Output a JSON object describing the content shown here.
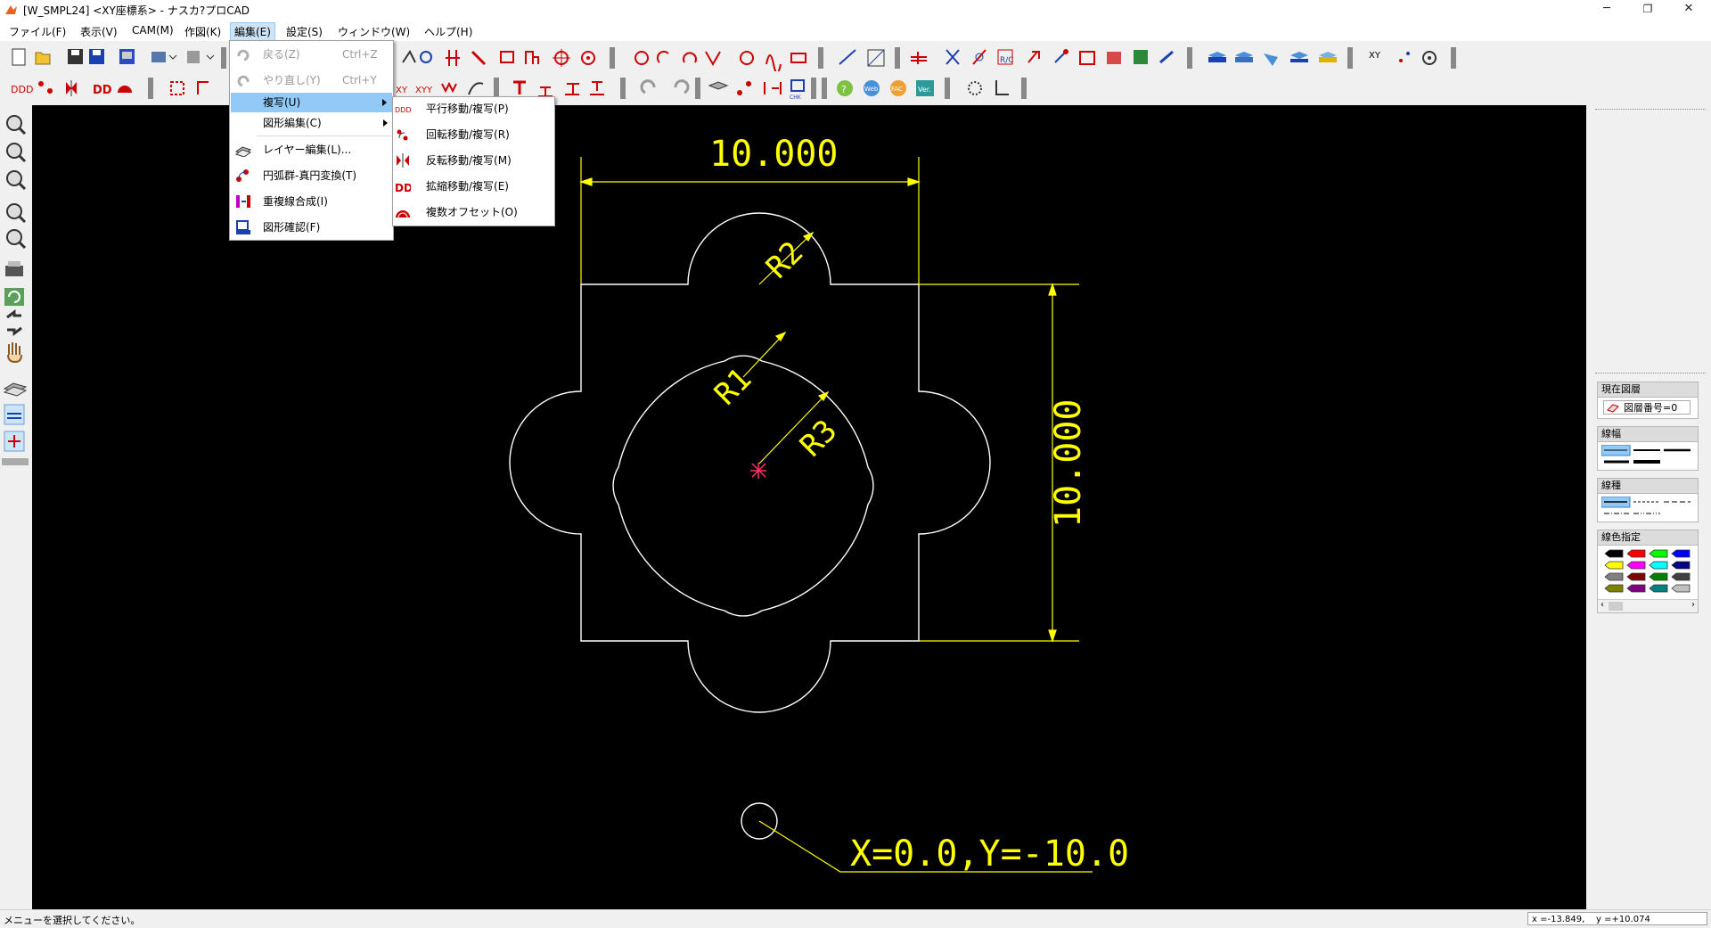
{
  "window": {
    "title": "[W_SMPL24] <XY座標系> - ナスカ?プロCAD",
    "minimize_glyph": "─",
    "maximize_glyph": "❐",
    "close_glyph": "✕"
  },
  "menubar": [
    {
      "label": "ファイル(F)"
    },
    {
      "label": "表示(V)"
    },
    {
      "label": "CAM(M)"
    },
    {
      "label": "作図(K)"
    },
    {
      "label": "編集(E)"
    },
    {
      "label": "設定(S)"
    },
    {
      "label": "ウィンドウ(W)"
    },
    {
      "label": "ヘルプ(H)"
    }
  ],
  "edit_menu": {
    "items": [
      {
        "label": "戻る(Z)",
        "shortcut": "Ctrl+Z",
        "disabled": true
      },
      {
        "label": "やり直し(Y)",
        "shortcut": "Ctrl+Y",
        "disabled": true
      },
      {
        "label": "複写(U)",
        "submenu": true,
        "highlighted": true
      },
      {
        "label": "図形編集(C)",
        "submenu": true
      },
      {
        "label": "レイヤー編集(L)..."
      },
      {
        "label": "円弧群-真円変換(T)"
      },
      {
        "label": "重複線合成(I)"
      },
      {
        "label": "図形確認(F)"
      }
    ]
  },
  "copy_submenu": {
    "items": [
      {
        "label": "平行移動/複写(P)"
      },
      {
        "label": "回転移動/複写(R)"
      },
      {
        "label": "反転移動/複写(M)"
      },
      {
        "label": "拡縮移動/複写(E)"
      },
      {
        "label": "複数オフセット(O)"
      }
    ]
  },
  "toolbar": {
    "xy_label": "XY",
    "r_c_label": "R/C",
    "web_label": "Web",
    "fac_label": "FAC",
    "ver_label": "Ver.",
    "chk_label": "CHK"
  },
  "drawing": {
    "dim_top": "10.000",
    "dim_right": "10.000",
    "label_r1": "R1",
    "label_r2": "R2",
    "label_r3": "R3",
    "annotation": "X=0.0,Y=-10.0",
    "line_color": "#ffffff",
    "dim_color": "#ffff00",
    "origin_color": "#ff3366"
  },
  "right_panel": {
    "layer_title": "現在図層",
    "layer_value": "図層番号=0",
    "linewidth_title": "線幅",
    "linetype_title": "線種",
    "color_title": "線色指定",
    "palette": [
      "#000000",
      "#ff0000",
      "#00ff00",
      "#0000ff",
      "#ffff00",
      "#ff00ff",
      "#00ffff",
      "#000080",
      "#808080",
      "#800000",
      "#008000",
      "#404040",
      "#808000",
      "#800080",
      "#008080",
      "#c0c0c0"
    ]
  },
  "statusbar": {
    "message": "メニューを選択してください。",
    "coords": "x =-13.849,    y =+10.074"
  }
}
